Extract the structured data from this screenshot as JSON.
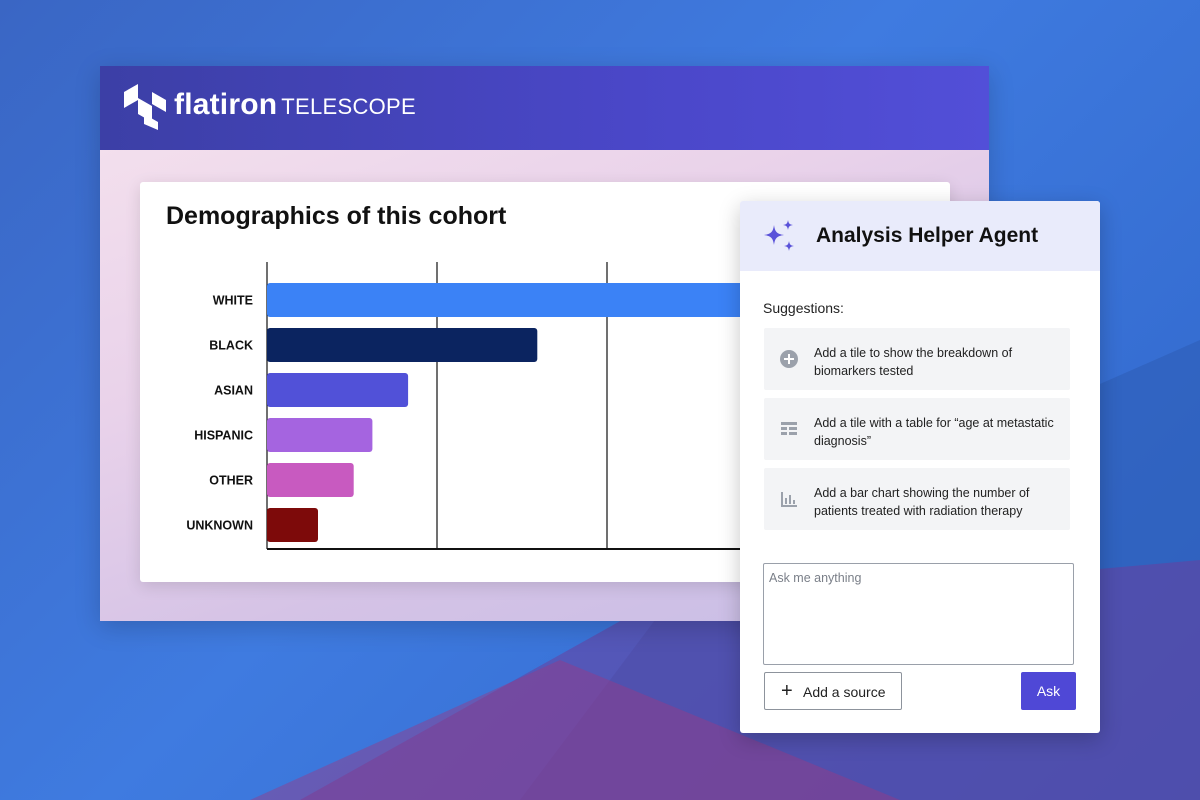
{
  "app": {
    "brand_primary": "flatiron",
    "brand_secondary": "TELESCOPE"
  },
  "chart_card": {
    "title": "Demographics of this cohort"
  },
  "chart_data": {
    "type": "bar",
    "orientation": "horizontal",
    "title": "Demographics of this cohort",
    "categories": [
      "WHITE",
      "BLACK",
      "ASIAN",
      "HISPANIC",
      "OTHER",
      "UNKNOWN"
    ],
    "values": [
      3.4,
      1.59,
      0.83,
      0.62,
      0.51,
      0.3
    ],
    "colors": [
      "#3b82f6",
      "#0b2460",
      "#5151d8",
      "#a564e0",
      "#c85ac0",
      "#7d0a0a"
    ],
    "xlim": [
      0,
      4
    ],
    "x_gridlines": [
      0,
      1,
      2,
      3
    ],
    "grid": true,
    "xlabel": "",
    "ylabel": ""
  },
  "agent": {
    "title": "Analysis Helper Agent",
    "suggestions_label": "Suggestions:",
    "suggestions": [
      {
        "icon": "plus-circle-icon",
        "text": "Add a tile to show the breakdown of biomarkers tested"
      },
      {
        "icon": "table-icon",
        "text": "Add a tile with a table for “age at metastatic diagnosis”"
      },
      {
        "icon": "bar-chart-icon",
        "text": "Add a bar chart showing the number of patients treated with radiation therapy"
      }
    ],
    "input_placeholder": "Ask me anything",
    "input_value": "",
    "add_source_label": "Add a source",
    "ask_label": "Ask",
    "accent_color": "#4f48d6"
  }
}
